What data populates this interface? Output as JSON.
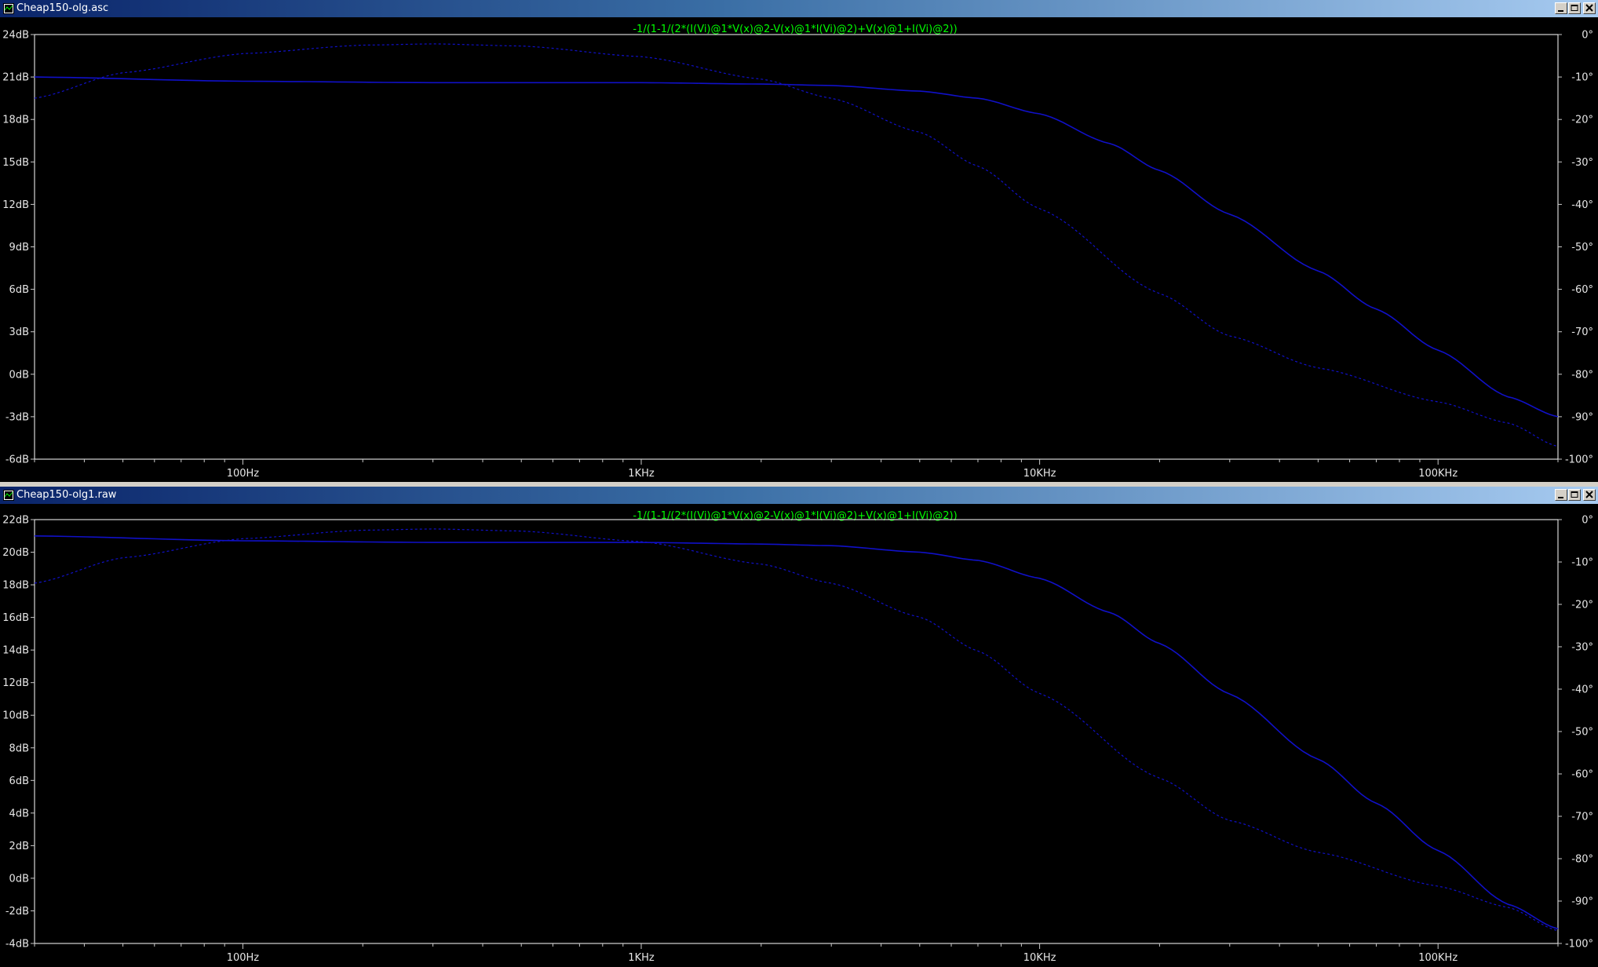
{
  "colors": {
    "trace": "#1010c8",
    "text": "#e6e6e6",
    "expr": "#00ff00",
    "frame": "#ffffff",
    "tick": "#c8c8c8"
  },
  "windows": [
    {
      "title": "Cheap150-olg.asc",
      "icon": "waveform-window-icon",
      "controls": [
        "minimize-icon",
        "maximize-icon",
        "close-icon"
      ],
      "expression": "-1/(1-1/(2*(I(Vi)@1*V(x)@2-V(x)@1*I(Vi)@2)+V(x)@1+I(Vi)@2))",
      "y_left_ticks": [
        "24dB",
        "21dB",
        "18dB",
        "15dB",
        "12dB",
        "9dB",
        "6dB",
        "3dB",
        "0dB",
        "-3dB",
        "-6dB"
      ],
      "y_right_ticks": [
        "0°",
        "-10°",
        "-20°",
        "-30°",
        "-40°",
        "-50°",
        "-60°",
        "-70°",
        "-80°",
        "-90°",
        "-100°"
      ],
      "x_ticks": [
        "100Hz",
        "1KHz",
        "10KHz",
        "100KHz"
      ]
    },
    {
      "title": "Cheap150-olg1.raw",
      "icon": "waveform-window-icon",
      "controls": [
        "minimize-icon",
        "maximize-icon",
        "close-icon"
      ],
      "expression": "-1/(1-1/(2*(I(Vi)@1*V(x)@2-V(x)@1*I(Vi)@2)+V(x)@1+I(Vi)@2))",
      "y_left_ticks": [
        "22dB",
        "20dB",
        "18dB",
        "16dB",
        "14dB",
        "12dB",
        "10dB",
        "8dB",
        "6dB",
        "4dB",
        "2dB",
        "0dB",
        "-2dB",
        "-4dB"
      ],
      "y_right_ticks": [
        "0°",
        "-10°",
        "-20°",
        "-30°",
        "-40°",
        "-50°",
        "-60°",
        "-70°",
        "-80°",
        "-90°",
        "-100°"
      ],
      "x_ticks": [
        "100Hz",
        "1KHz",
        "10KHz",
        "100KHz"
      ]
    }
  ],
  "chart_data": [
    {
      "type": "line",
      "x_scale": "log",
      "xlim": [
        30,
        200000
      ],
      "ylim": [
        -6,
        24
      ],
      "ylabel_unit": "dB",
      "y2lim": [
        -100,
        0
      ],
      "y2label_unit": "°",
      "series": [
        {
          "axis": "left",
          "style": "solid",
          "x": [
            30,
            100,
            300,
            1000,
            2000,
            3000,
            5000,
            7000,
            10000,
            15000,
            20000,
            30000,
            50000,
            70000,
            100000,
            150000,
            200000
          ],
          "values": [
            21.0,
            20.7,
            20.6,
            20.6,
            20.5,
            20.4,
            20.0,
            19.5,
            18.4,
            16.3,
            14.4,
            11.3,
            7.3,
            4.6,
            1.7,
            -1.6,
            -3.0
          ]
        },
        {
          "axis": "right",
          "style": "dashed",
          "x": [
            30,
            50,
            100,
            200,
            300,
            500,
            1000,
            2000,
            3000,
            5000,
            7000,
            10000,
            20000,
            30000,
            50000,
            100000,
            150000,
            200000
          ],
          "values": [
            -15,
            -9,
            -4.5,
            -2.5,
            -2.2,
            -2.7,
            -5.2,
            -10.5,
            -15,
            -23,
            -31,
            -41,
            -61,
            -71,
            -78.5,
            -86.5,
            -91.5,
            -97
          ]
        }
      ]
    },
    {
      "type": "line",
      "x_scale": "log",
      "xlim": [
        30,
        200000
      ],
      "ylim": [
        -4,
        22
      ],
      "ylabel_unit": "dB",
      "y2lim": [
        -100,
        0
      ],
      "y2label_unit": "°",
      "series": [
        {
          "axis": "left",
          "style": "solid",
          "x": [
            30,
            100,
            300,
            1000,
            2000,
            3000,
            5000,
            7000,
            10000,
            15000,
            20000,
            30000,
            50000,
            70000,
            100000,
            150000,
            200000
          ],
          "values": [
            21.0,
            20.7,
            20.6,
            20.6,
            20.5,
            20.4,
            20.0,
            19.5,
            18.4,
            16.3,
            14.4,
            11.3,
            7.3,
            4.6,
            1.7,
            -1.6,
            -3.1
          ]
        },
        {
          "axis": "right",
          "style": "dashed",
          "x": [
            30,
            50,
            100,
            200,
            300,
            500,
            1000,
            2000,
            3000,
            5000,
            7000,
            10000,
            20000,
            30000,
            50000,
            100000,
            150000,
            200000
          ],
          "values": [
            -15,
            -9,
            -4.5,
            -2.5,
            -2.2,
            -2.7,
            -5.2,
            -10.5,
            -15,
            -23,
            -31,
            -41,
            -61,
            -71,
            -78.5,
            -86.5,
            -91.5,
            -97
          ]
        }
      ]
    }
  ]
}
